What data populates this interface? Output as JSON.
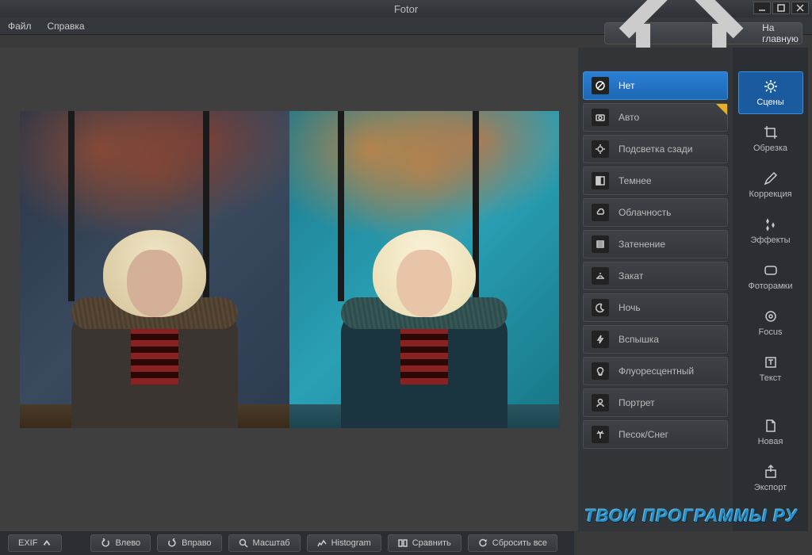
{
  "app": {
    "title": "Fotor"
  },
  "menu": {
    "file": "Файл",
    "help": "Справка"
  },
  "home_button": "На главную",
  "scenes": [
    {
      "id": "none",
      "label": "Нет",
      "icon": "none",
      "active": true
    },
    {
      "id": "auto",
      "label": "Авто",
      "icon": "camera",
      "star": true
    },
    {
      "id": "backlit",
      "label": "Подсветка сзади",
      "icon": "backlit"
    },
    {
      "id": "darken",
      "label": "Темнее",
      "icon": "darken"
    },
    {
      "id": "cloudy",
      "label": "Облачность",
      "icon": "cloud"
    },
    {
      "id": "shade",
      "label": "Затенение",
      "icon": "shade"
    },
    {
      "id": "sunset",
      "label": "Закат",
      "icon": "sunset"
    },
    {
      "id": "night",
      "label": "Ночь",
      "icon": "moon"
    },
    {
      "id": "flash",
      "label": "Вспышка",
      "icon": "flash"
    },
    {
      "id": "fluorescent",
      "label": "Флуоресцентный",
      "icon": "bulb"
    },
    {
      "id": "portrait",
      "label": "Портрет",
      "icon": "portrait"
    },
    {
      "id": "sandsnow",
      "label": "Песок/Снег",
      "icon": "palm"
    }
  ],
  "tool_tabs": [
    {
      "id": "scenes",
      "label": "Сцены",
      "icon": "sun",
      "active": true
    },
    {
      "id": "crop",
      "label": "Обрезка",
      "icon": "crop"
    },
    {
      "id": "adjust",
      "label": "Коррекция",
      "icon": "pencil"
    },
    {
      "id": "effects",
      "label": "Эффекты",
      "icon": "sparkle"
    },
    {
      "id": "frames",
      "label": "Фоторамки",
      "icon": "frame"
    },
    {
      "id": "focus",
      "label": "Focus",
      "icon": "target"
    },
    {
      "id": "text",
      "label": "Текст",
      "icon": "text"
    }
  ],
  "tool_tabs_secondary": [
    {
      "id": "new",
      "label": "Новая",
      "icon": "file"
    },
    {
      "id": "export",
      "label": "Экспорт",
      "icon": "export"
    }
  ],
  "bottom_bar": {
    "exif": "EXIF",
    "rotate_left": "Влево",
    "rotate_right": "Вправо",
    "zoom": "Масштаб",
    "histogram": "Histogram",
    "compare": "Сравнить",
    "reset": "Сбросить все"
  },
  "watermark": "ТВОИ ПРОГРАММЫ РУ"
}
